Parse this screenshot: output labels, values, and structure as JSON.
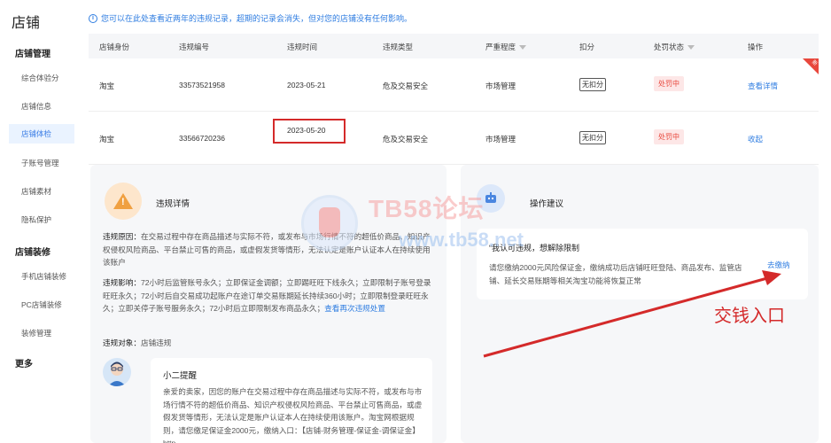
{
  "sidebar": {
    "title": "店铺",
    "groups": [
      {
        "label": "店铺管理",
        "items": [
          "综合体验分",
          "店铺信息",
          "店铺体检",
          "子账号管理",
          "店铺素材",
          "隐私保护"
        ]
      },
      {
        "label": "店铺装修",
        "items": [
          "手机店铺装修",
          "PC店铺装修",
          "装修管理"
        ]
      }
    ],
    "more": "更多",
    "active_item": "店铺体检"
  },
  "notice": {
    "icon": "info-icon",
    "text": "您可以在此处查看近两年的违规记录，超期的记录会消失，但对您的店铺没有任何影响。"
  },
  "table": {
    "columns": [
      "店铺身份",
      "违规编号",
      "违规时间",
      "违规类型",
      "严重程度",
      "扣分",
      "处罚状态",
      "操作"
    ],
    "rows": [
      {
        "shop": "淘宝",
        "id": "33573521958",
        "time": "2023-05-21",
        "type": "危及交易安全",
        "severity": "市场管理",
        "deduct": "无扣分",
        "status": "处罚中",
        "action": "查看详情"
      },
      {
        "shop": "淘宝",
        "id": "33566720236",
        "time": "2023-05-20",
        "type": "危及交易安全",
        "severity": "市场管理",
        "deduct": "无扣分",
        "status": "处罚中",
        "action": "收起"
      }
    ],
    "corner_tag": "新"
  },
  "detail": {
    "title": "违规详情",
    "reason_label": "违规原因：",
    "reason_text": "在交易过程中存在商品描述与实际不符，或发布与市场行情不符的超低价商品、知识产权侵权风险商品、平台禁止可售的商品，或虚假发货等情形，无法认定是账户认证本人在持续使用该账户",
    "impact_label": "违规影响：",
    "impact_text": "72小时后监管账号永久；立即保证金调额；立即踢旺旺下线永久；立即限制子账号登录旺旺永久；72小时后自交易成功起账户在途订单交易账期延长持续360小时；立即限制登录旺旺永久；立即关停子账号服务永久；72小时后立即限制发布商品永久；",
    "impact_link": "查看再次违规处置",
    "target_label": "违规对象：",
    "target_text": "店铺违规"
  },
  "reminder": {
    "title": "小二提醒",
    "body": "亲爱的卖家，因您的账户在交易过程中存在商品描述与实际不符，或发布与市场行情不符的超低价商品、知识产权侵权风险商品、平台禁止可售商品，或虚假发货等情形，无法认定是账户认证本人在持续使用该账户。淘宝网根据规则，请您缴足保证金2000元，缴纳入口：【店铺-财务管理-保证金-调保证金】http"
  },
  "suggest": {
    "title": "操作建议",
    "card_title": "“我认可违规，想解除限制",
    "card_body": "请您缴纳2000元风险保证金，缴纳成功后店铺旺旺登陆、商品发布、监管店铺、延长交易账期等相关淘宝功能将恢复正常",
    "pay_link": "去缴纳"
  },
  "watermark": {
    "line1": "TB58论坛",
    "line2": "www.tb58.net"
  },
  "annotation": {
    "text": "交钱入口",
    "color": "#d42a2a"
  },
  "colors": {
    "accent": "#2f7de1",
    "danger": "#e8473c",
    "warn": "#f0a040"
  }
}
